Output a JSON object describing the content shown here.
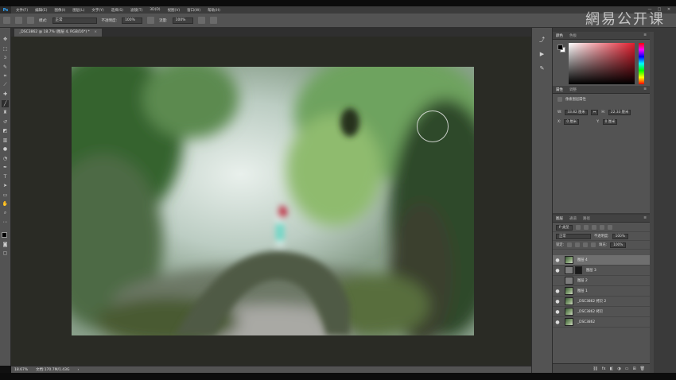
{
  "menubar": {
    "logo": "Ps",
    "items": [
      "文件(F)",
      "编辑(E)",
      "图像(I)",
      "图层(L)",
      "文字(Y)",
      "选择(S)",
      "滤镜(T)",
      "3D(D)",
      "视图(V)",
      "窗口(W)",
      "帮助(H)"
    ],
    "window_buttons": [
      "—",
      "□",
      "✕"
    ]
  },
  "watermark": "網易公开课",
  "options": {
    "mode_label": "模式:",
    "mode_value": "正常",
    "opacity_label": "不透明度:",
    "opacity_value": "100%",
    "flow_label": "流量:",
    "flow_value": "100%"
  },
  "document": {
    "tab_title": "_DSC3862 @ 18.7% (图层 4, RGB/16*) *",
    "close": "×",
    "zoom": "18.67%",
    "doc_info": "文档:170.7M/1.43G",
    "status_arrow": "›"
  },
  "color_panel": {
    "tabs": [
      "颜色",
      "色板"
    ],
    "menu": "≡",
    "accent": "#e01e2e"
  },
  "properties_panel": {
    "tabs": [
      "属性",
      "调整"
    ],
    "menu": "≡",
    "title": "像素图层属性",
    "w_label": "W:",
    "w_value": "33.82 厘米",
    "h_label": "H:",
    "h_value": "22.33 厘米",
    "x_label": "X:",
    "x_value": "0 厘米",
    "y_label": "Y:",
    "y_value": "0 厘米",
    "link": "⇔"
  },
  "layers_panel": {
    "tabs": [
      "图层",
      "通道",
      "路径"
    ],
    "menu": "≡",
    "filter_label": "P 类型",
    "blend_value": "正常",
    "opacity_label": "不透明度:",
    "opacity_value": "100%",
    "lock_label": "锁定:",
    "fill_label": "填充:",
    "fill_value": "100%",
    "layers": [
      {
        "name": "图层 4",
        "visible": true,
        "selected": true,
        "thumb": "photo"
      },
      {
        "name": "图层 3",
        "visible": true,
        "selected": false,
        "thumb": "gray-mask"
      },
      {
        "name": "图层 2",
        "visible": false,
        "selected": false,
        "thumb": "gray"
      },
      {
        "name": "图层 1",
        "visible": true,
        "selected": false,
        "thumb": "photo"
      },
      {
        "name": "_DSC3862 拷贝 2",
        "visible": true,
        "selected": false,
        "thumb": "photo"
      },
      {
        "name": "_DSC3862 拷贝",
        "visible": true,
        "selected": false,
        "thumb": "photo"
      },
      {
        "name": "_DSC3862",
        "visible": true,
        "selected": false,
        "thumb": "photo"
      }
    ],
    "footer_icons": [
      "⛓",
      "fx",
      "◧",
      "◑",
      "▭",
      "⊞",
      "🗑"
    ]
  },
  "tools": [
    "move-tool",
    "marquee-tool",
    "lasso-tool",
    "quick-select-tool",
    "crop-tool",
    "eyedropper-tool",
    "healing-tool",
    "brush-tool",
    "stamp-tool",
    "history-brush-tool",
    "eraser-tool",
    "gradient-tool",
    "blur-tool",
    "dodge-tool",
    "pen-tool",
    "type-tool",
    "path-select-tool",
    "shape-tool",
    "hand-tool",
    "zoom-tool"
  ]
}
